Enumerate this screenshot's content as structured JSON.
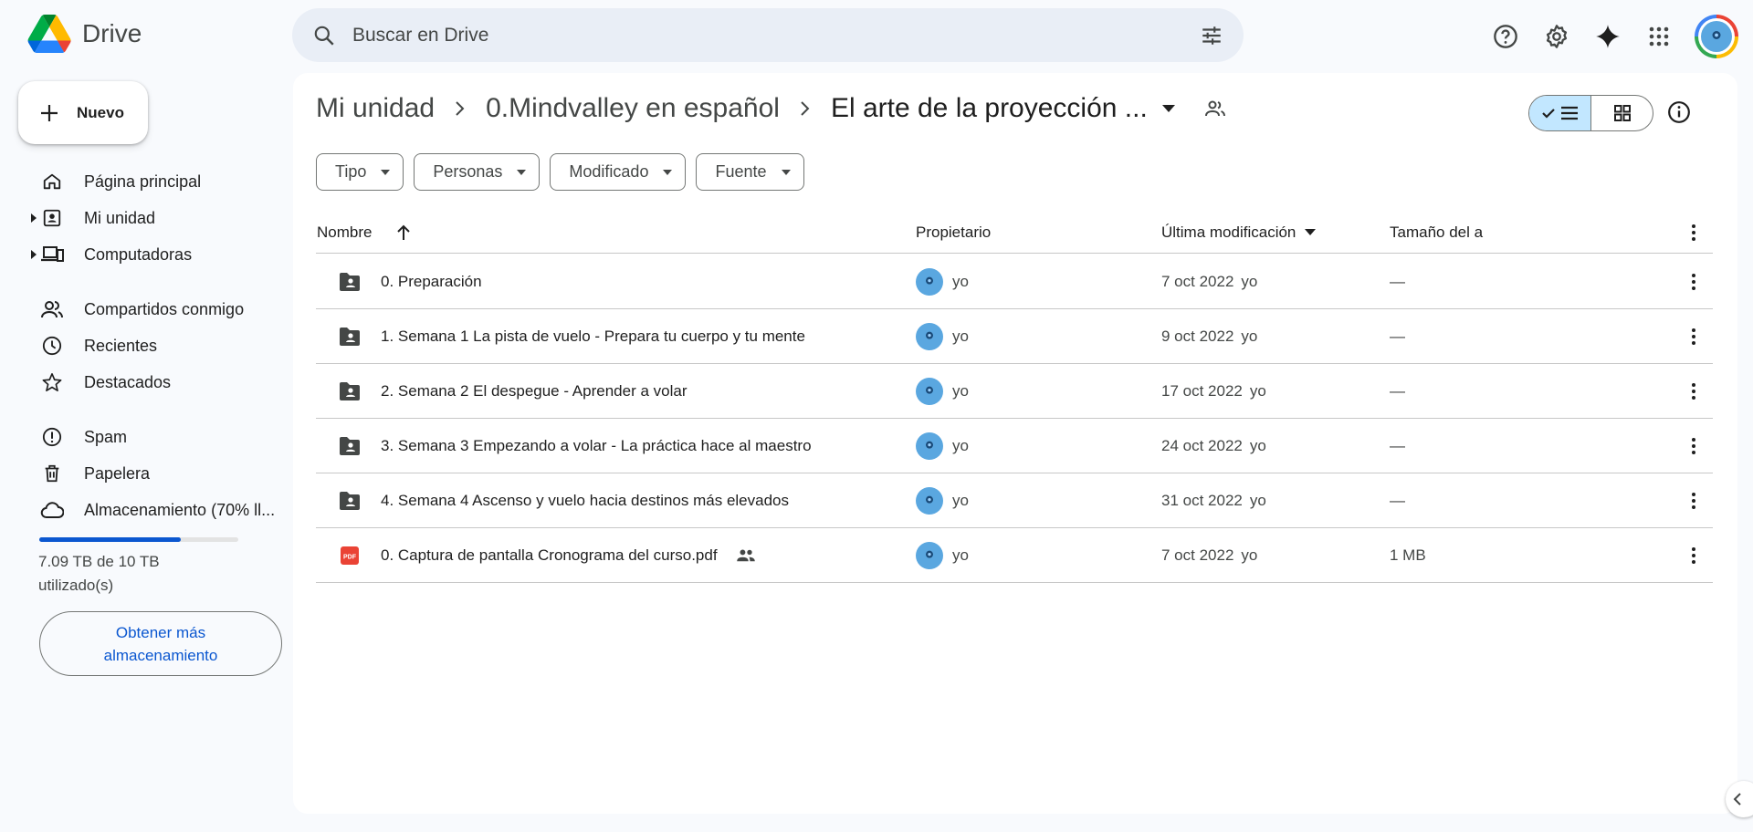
{
  "app": {
    "name": "Drive"
  },
  "search": {
    "placeholder": "Buscar en Drive"
  },
  "sidebar": {
    "new_label": "Nuevo",
    "items": [
      {
        "label": "Página principal",
        "icon": "home-icon"
      },
      {
        "label": "Mi unidad",
        "icon": "my-drive-icon"
      },
      {
        "label": "Computadoras",
        "icon": "computers-icon"
      },
      {
        "label": "Compartidos conmigo",
        "icon": "shared-icon"
      },
      {
        "label": "Recientes",
        "icon": "clock-icon"
      },
      {
        "label": "Destacados",
        "icon": "star-icon"
      },
      {
        "label": "Spam",
        "icon": "spam-icon"
      },
      {
        "label": "Papelera",
        "icon": "trash-icon"
      },
      {
        "label": "Almacenamiento (70% ll...",
        "icon": "cloud-icon"
      }
    ],
    "storage": {
      "used_fraction": 0.709,
      "text": "7.09 TB de 10 TB utilizado(s)"
    },
    "more_storage_label": "Obtener más almacenamiento"
  },
  "breadcrumb": {
    "items": [
      "Mi unidad",
      "0.Mindvalley en español",
      "El arte de la proyección ..."
    ]
  },
  "filters": [
    "Tipo",
    "Personas",
    "Modificado",
    "Fuente"
  ],
  "table": {
    "columns": {
      "name": "Nombre",
      "owner": "Propietario",
      "modified": "Última modificación",
      "size": "Tamaño del a"
    },
    "rows": [
      {
        "name": "0. Preparación",
        "type": "folder",
        "owner": "yo",
        "modified": "7 oct 2022",
        "modified_by": "yo",
        "size": "—"
      },
      {
        "name": "1. Semana 1 La pista de vuelo - Prepara tu cuerpo y tu mente",
        "type": "folder",
        "owner": "yo",
        "modified": "9 oct 2022",
        "modified_by": "yo",
        "size": "—"
      },
      {
        "name": "2. Semana 2 El despegue - Aprender a volar",
        "type": "folder",
        "owner": "yo",
        "modified": "17 oct 2022",
        "modified_by": "yo",
        "size": "—"
      },
      {
        "name": "3. Semana 3 Empezando a volar - La práctica hace al maestro",
        "type": "folder",
        "owner": "yo",
        "modified": "24 oct 2022",
        "modified_by": "yo",
        "size": "—"
      },
      {
        "name": "4. Semana 4 Ascenso y vuelo hacia destinos más elevados",
        "type": "folder",
        "owner": "yo",
        "modified": "31 oct 2022",
        "modified_by": "yo",
        "size": "—"
      },
      {
        "name": "0. Captura de pantalla Cronograma del curso.pdf",
        "type": "pdf",
        "owner": "yo",
        "modified": "7 oct 2022",
        "modified_by": "yo",
        "size": "1 MB",
        "shared": true
      }
    ]
  },
  "colors": {
    "accent": "#0b57d0",
    "selected": "#c2e7ff",
    "pdf": "#ea4335"
  }
}
